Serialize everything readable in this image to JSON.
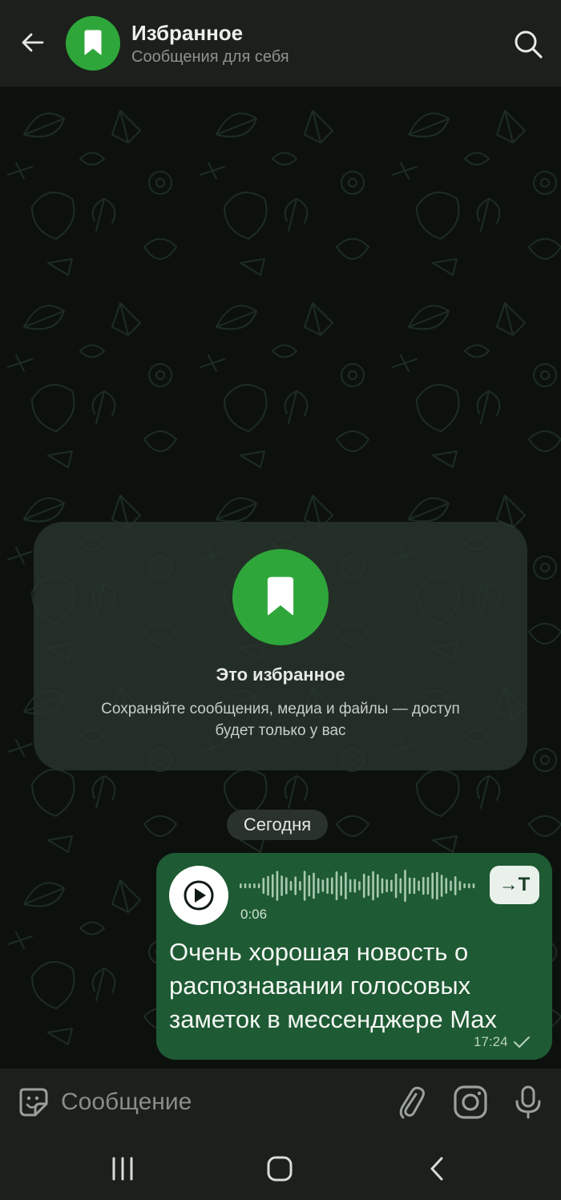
{
  "header": {
    "title": "Избранное",
    "subtitle": "Сообщения для себя",
    "back_icon": "arrow-left-icon",
    "search_icon": "search-icon",
    "avatar_icon": "bookmark-icon",
    "avatar_color": "#2ea63a"
  },
  "intro": {
    "title": "Это избранное",
    "text": "Сохраняйте сообщения, медиа и файлы — доступ будет только у вас",
    "icon": "bookmark-icon"
  },
  "chat": {
    "date_separator": "Сегодня",
    "messages": [
      {
        "type": "voice",
        "duration": "0:06",
        "transcribe_label": "→T",
        "transcript": "Очень хорошая новость о распознавании голосовых заметок в мессенджере Max",
        "time": "17:24",
        "status": "sent",
        "bubble_color": "#1e5a33"
      }
    ]
  },
  "input": {
    "placeholder": "Сообщение",
    "value": "",
    "icons": [
      "sticker-icon",
      "paperclip-icon",
      "instagram-icon",
      "microphone-icon"
    ]
  },
  "nav": {
    "icons": [
      "recents-icon",
      "home-icon",
      "back-icon"
    ]
  }
}
